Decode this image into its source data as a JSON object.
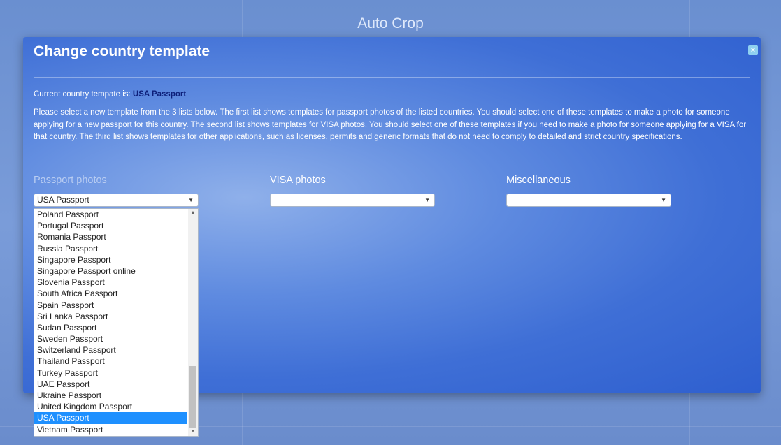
{
  "app": {
    "title": "Auto Crop"
  },
  "modal": {
    "title": "Change country template",
    "close_label": "×",
    "current_label": "Current country tempate is: ",
    "current_value": "USA Passport",
    "intro": "Please select a new template from the 3 lists below. The first list shows templates for passport photos of the listed countries. You should select one of these templates to make a photo for someone applying for a new passport for this country. The second list shows templates for VISA photos. You should select one of these templates if you need to make a photo for someone applying for a VISA for that country. The third list shows templates for other applications, such as licenses, permits and generic formats that do not need to comply to detailed and strict country specifications."
  },
  "columns": {
    "passport": {
      "label": "Passport photos",
      "selected": "USA Passport"
    },
    "visa": {
      "label": "VISA photos",
      "selected": ""
    },
    "misc": {
      "label": "Miscellaneous",
      "selected": ""
    }
  },
  "dropdown": {
    "options": [
      "Poland Passport",
      "Portugal Passport",
      "Romania Passport",
      "Russia Passport",
      "Singapore Passport",
      "Singapore Passport online",
      "Slovenia Passport",
      "South Africa Passport",
      "Spain Passport",
      "Sri Lanka Passport",
      "Sudan Passport",
      "Sweden Passport",
      "Switzerland Passport",
      "Thailand Passport",
      "Turkey Passport",
      "UAE Passport",
      "Ukraine Passport",
      "United Kingdom Passport",
      "USA Passport",
      "Vietnam Passport"
    ],
    "selected_index": 18
  },
  "colors": {
    "accent": "#1e90ff",
    "current_value": "#0d1f7a"
  }
}
